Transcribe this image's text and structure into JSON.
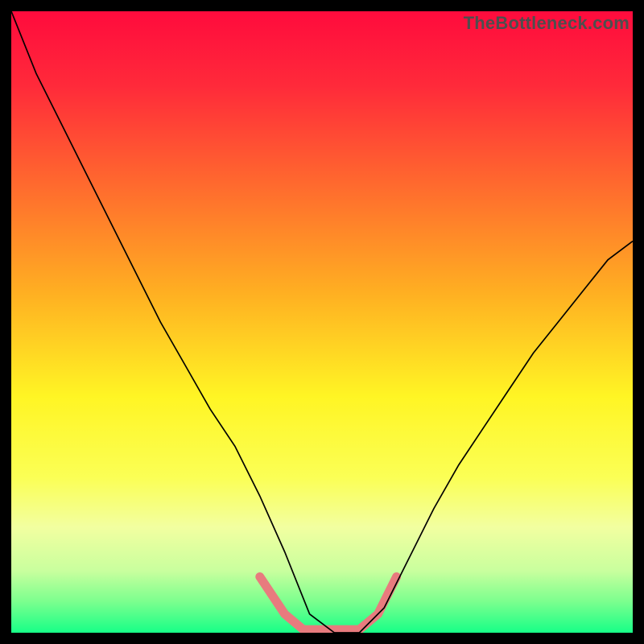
{
  "watermark": "TheBottleneck.com",
  "chart_data": {
    "type": "line",
    "title": "",
    "xlabel": "",
    "ylabel": "",
    "xlim": [
      0,
      100
    ],
    "ylim": [
      0,
      100
    ],
    "grid": false,
    "legend": false,
    "gradient_stops": [
      {
        "offset": 0,
        "color": "#ff0b3d"
      },
      {
        "offset": 0.12,
        "color": "#ff2a3a"
      },
      {
        "offset": 0.28,
        "color": "#ff6a2e"
      },
      {
        "offset": 0.45,
        "color": "#ffae22"
      },
      {
        "offset": 0.62,
        "color": "#fff524"
      },
      {
        "offset": 0.75,
        "color": "#fbff55"
      },
      {
        "offset": 0.83,
        "color": "#f2ffa0"
      },
      {
        "offset": 0.9,
        "color": "#c9ff9e"
      },
      {
        "offset": 0.95,
        "color": "#7bff8e"
      },
      {
        "offset": 1.0,
        "color": "#17ff87"
      }
    ],
    "series": [
      {
        "name": "bottleneck-curve",
        "stroke": "#000000",
        "stroke_width": 1.7,
        "x": [
          0,
          4,
          8,
          12,
          16,
          20,
          24,
          28,
          32,
          36,
          40,
          44,
          48,
          52,
          56,
          60,
          64,
          68,
          72,
          76,
          80,
          84,
          88,
          92,
          96,
          100
        ],
        "y": [
          100,
          90,
          82,
          74,
          66,
          58,
          50,
          43,
          36,
          30,
          22,
          13,
          3,
          0,
          0,
          4,
          12,
          20,
          27,
          33,
          39,
          45,
          50,
          55,
          60,
          63
        ]
      },
      {
        "name": "bottom-band",
        "stroke": "#e87b7e",
        "stroke_width": 11,
        "linecap": "round",
        "x": [
          40,
          44,
          47,
          50,
          53,
          56,
          59,
          62
        ],
        "y": [
          9,
          3,
          0.5,
          0.5,
          0.5,
          0.5,
          3,
          9
        ]
      }
    ]
  }
}
